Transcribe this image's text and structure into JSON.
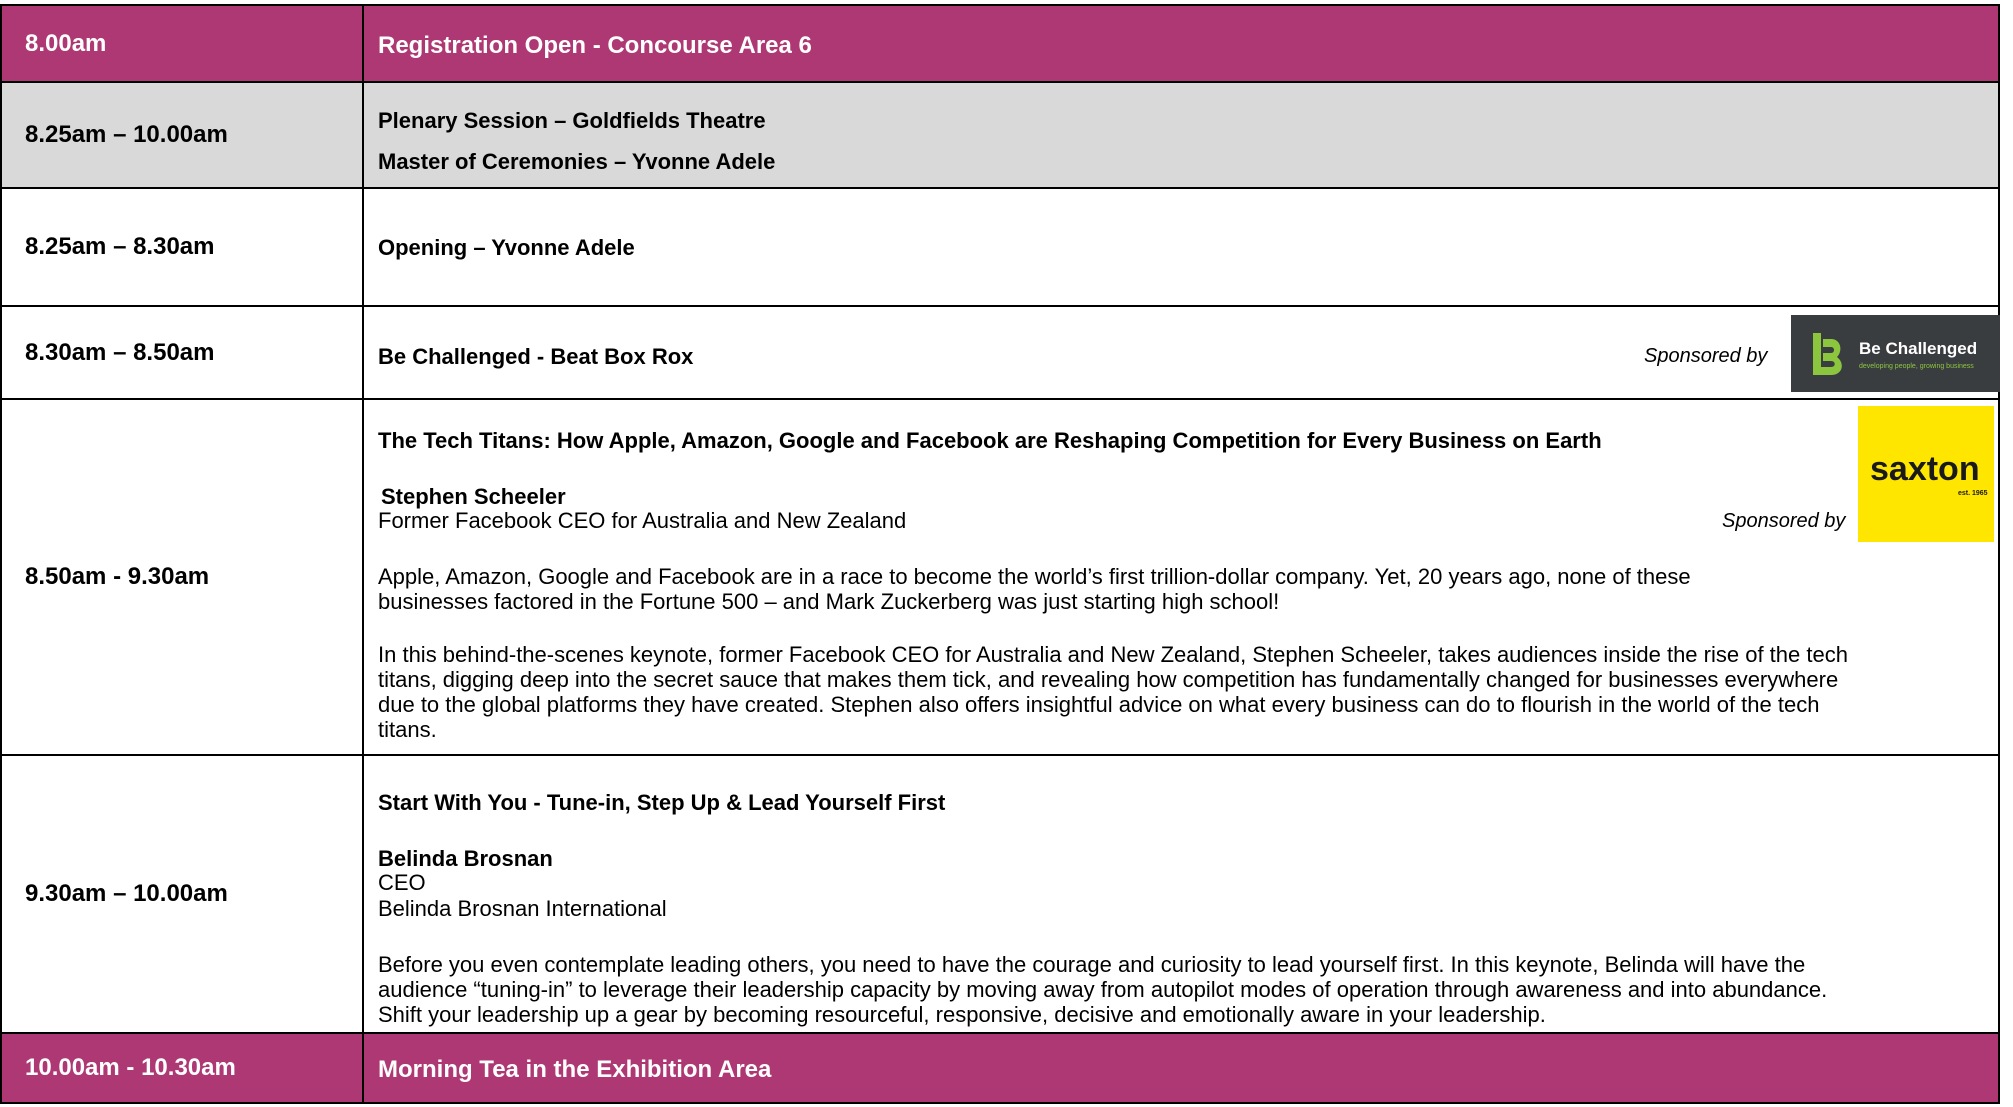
{
  "colors": {
    "accent": "#ad3873",
    "grey": "#d9d9d9",
    "logo_dark": "#3a3d40",
    "logo_green": "#8cc63f",
    "logo_yellow": "#ffe600"
  },
  "rows": [
    {
      "time": "8.00am",
      "title": "Registration Open - Concourse Area 6"
    },
    {
      "time": "8.25am – 10.00am",
      "title": "Plenary Session – Goldfields Theatre",
      "subtitle": "Master of Ceremonies – Yvonne Adele"
    },
    {
      "time": "8.25am – 8.30am",
      "title": "Opening – Yvonne Adele"
    },
    {
      "time": "8.30am – 8.50am",
      "title": "Be Challenged - Beat Box Rox",
      "sponsor_label": "Sponsored by",
      "logo_text": "Be Challenged",
      "logo_tagline": "developing people, growing business",
      "logo_icon": "be-challenged-logo-icon"
    },
    {
      "time": "8.50am - 9.30am",
      "title": "The Tech Titans: How Apple, Amazon, Google and Facebook are Reshaping Competition for Every Business on Earth",
      "speaker": "Stephen Scheeler",
      "role": "Former Facebook CEO for Australia and New Zealand",
      "sponsor_label": "Sponsored by",
      "logo_text": "saxton",
      "logo_sub": "est. 1965",
      "para1_l1": "Apple, Amazon, Google and Facebook are in a race to become the world’s first trillion-dollar company. Yet, 20 years ago, none of these",
      "para1_l2": "businesses factored in the Fortune 500 – and Mark Zuckerberg was just starting high school!",
      "para2_l1": "In this behind-the-scenes keynote, former Facebook CEO for Australia and New Zealand, Stephen Scheeler, takes audiences inside the rise of the tech",
      "para2_l2": "titans, digging deep into the secret sauce that makes them tick, and revealing how competition has fundamentally changed for businesses everywhere",
      "para2_l3": "due to the global platforms they have created. Stephen also offers insightful advice on what every business can do to flourish in the world of the tech",
      "para2_l4": "titans."
    },
    {
      "time": "9.30am – 10.00am",
      "title": "Start With You - Tune-in, Step Up & Lead Yourself First",
      "speaker": "Belinda Brosnan",
      "role": "CEO",
      "org": "Belinda Brosnan International",
      "para_l1": "Before you even contemplate leading others, you need to have the courage and curiosity to lead yourself first. In this keynote, Belinda will have the",
      "para_l2": "audience “tuning-in” to leverage their leadership capacity by moving away from autopilot modes of operation through awareness and into abundance.",
      "para_l3": "Shift your leadership up a gear by becoming resourceful, responsive, decisive and emotionally aware in your leadership."
    },
    {
      "time": "10.00am - 10.30am",
      "title": "Morning Tea in the Exhibition Area"
    }
  ]
}
